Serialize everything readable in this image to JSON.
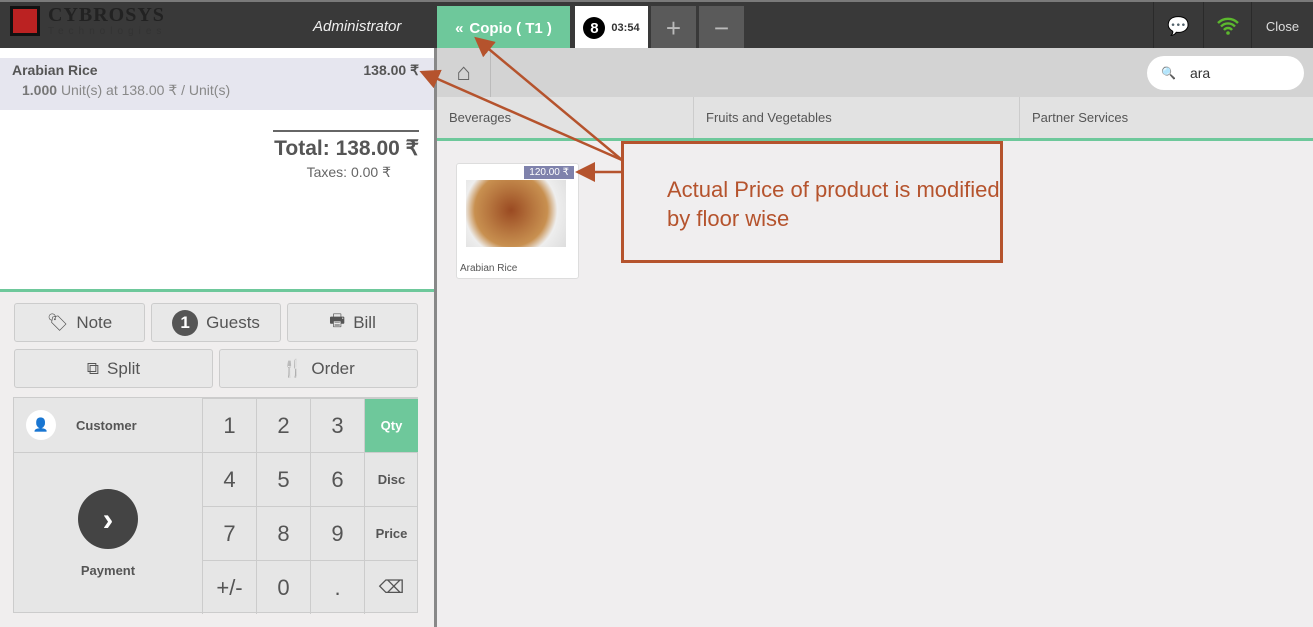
{
  "header": {
    "logo_title": "CYBROSYS",
    "logo_subtitle": "Technologies",
    "user": "Administrator",
    "current_table": "Copio ( T1 )",
    "order_badge": "8",
    "order_time": "03:54",
    "add_label": "+",
    "remove_label": "−",
    "close_label": "Close",
    "wifi_color": "#5cb82e"
  },
  "order": {
    "line": {
      "name": "Arabian Rice",
      "price": "138.00 ₹",
      "qty": "1.000",
      "detail": "Unit(s) at 138.00 ₹ / Unit(s)"
    },
    "total": "Total: 138.00 ₹",
    "taxes": "Taxes: 0.00 ₹"
  },
  "controls": {
    "note": "Note",
    "guests_count": "1",
    "guests": "Guests",
    "bill": "Bill",
    "split": "Split",
    "order": "Order"
  },
  "numpad": {
    "customer": "Customer",
    "payment": "Payment",
    "keys": [
      "1",
      "2",
      "3",
      "Qty",
      "4",
      "5",
      "6",
      "Disc",
      "7",
      "8",
      "9",
      "Price",
      "+/-",
      "0",
      "."
    ],
    "accent": "#6ec89b"
  },
  "products": {
    "search_value": "ara",
    "categories": [
      "Beverages",
      "Fruits and Vegetables",
      "Partner Services"
    ],
    "items": [
      {
        "name": "Arabian Rice",
        "price": "120.00 ₹"
      }
    ]
  },
  "annotation": {
    "text": "Actual Price of product is modified by floor wise",
    "color": "#b5532d"
  }
}
